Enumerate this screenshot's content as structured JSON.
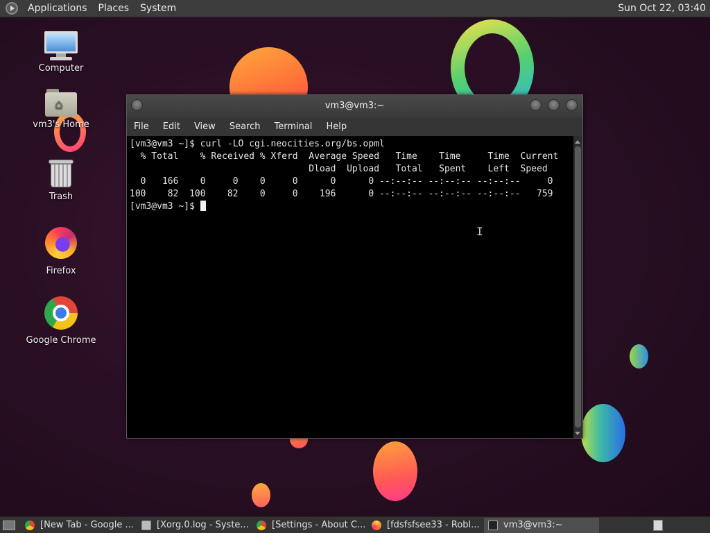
{
  "top_panel": {
    "menus": [
      "Applications",
      "Places",
      "System"
    ],
    "clock": "Sun Oct 22, 03:40"
  },
  "desktop_icons": [
    {
      "label": "Computer",
      "icon": "computer-icon"
    },
    {
      "label": "vm3's Home",
      "icon": "home-folder-icon"
    },
    {
      "label": "Trash",
      "icon": "trash-icon"
    },
    {
      "label": "Firefox",
      "icon": "firefox-icon"
    },
    {
      "label": "Google Chrome",
      "icon": "chrome-icon"
    }
  ],
  "terminal": {
    "title": "vm3@vm3:~",
    "menu": [
      "File",
      "Edit",
      "View",
      "Search",
      "Terminal",
      "Help"
    ],
    "lines": [
      "[vm3@vm3 ~]$ curl -LO cgi.neocities.org/bs.opml",
      "  % Total    % Received % Xferd  Average Speed   Time    Time     Time  Current",
      "                                 Dload  Upload   Total   Spent    Left  Speed",
      "  0   166    0     0    0     0      0      0 --:--:-- --:--:-- --:--:--     0",
      "100    82  100    82    0     0    196      0 --:--:-- --:--:-- --:--:--   759"
    ],
    "prompt": "[vm3@vm3 ~]$ "
  },
  "taskbar": {
    "tasks": [
      {
        "label": "[New Tab - Google ...",
        "icon": "chrome-icon"
      },
      {
        "label": "[Xorg.0.log - Syste...",
        "icon": "text-editor-icon"
      },
      {
        "label": "[Settings - About C...",
        "icon": "chrome-icon"
      },
      {
        "label": "[fdsfsfsee33 - Robl...",
        "icon": "firefox-icon"
      },
      {
        "label": "vm3@vm3:~",
        "icon": "terminal-icon"
      }
    ]
  }
}
